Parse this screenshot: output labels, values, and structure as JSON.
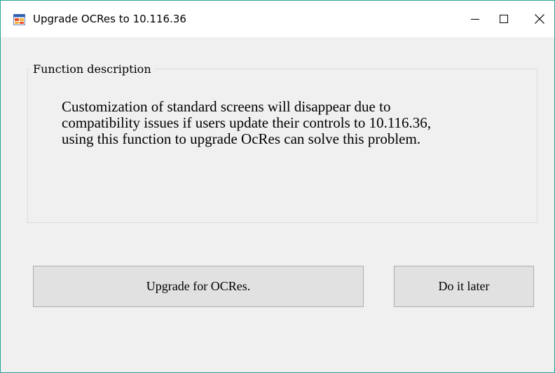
{
  "window": {
    "title": "Upgrade OCRes to 10.116.36",
    "controls": {
      "minimize_icon": "minimize-icon",
      "maximize_icon": "maximize-icon",
      "close_icon": "close-icon"
    },
    "accent_border_color": "#2aa39a",
    "background_color": "#f0f0f0"
  },
  "group": {
    "title": "Function description",
    "description_lines": [
      "Customization of standard screens will disappear due to",
      "compatibility issues if users update their controls to 10.116.36,",
      "using this function to upgrade OcRes can solve this problem."
    ]
  },
  "buttons": {
    "upgrade_label": "Upgrade for OCRes.",
    "later_label": "Do it later"
  }
}
